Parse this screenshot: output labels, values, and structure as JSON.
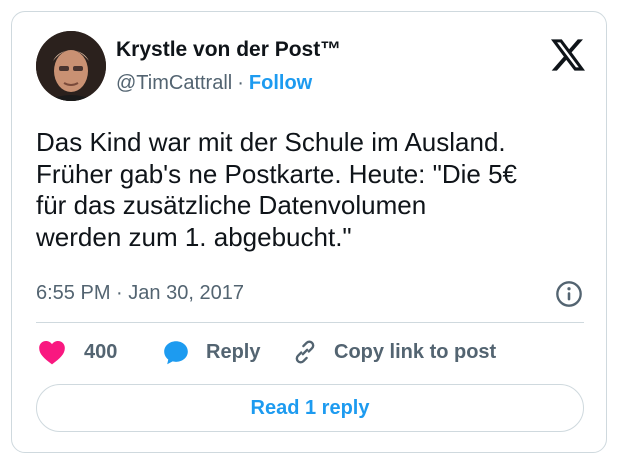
{
  "author": {
    "display_name": "Krystle von der Post™",
    "handle": "@TimCattrall",
    "separator": "·",
    "follow_label": "Follow"
  },
  "tweet": {
    "lines": [
      "Das Kind war mit der Schule im Ausland.",
      "Früher gab's ne Postkarte. Heute: \"Die 5€",
      "für das zusätzliche Datenvolumen",
      "werden zum 1. abgebucht.\""
    ],
    "time": "6:55 PM",
    "date_separator": "·",
    "date": "Jan 30, 2017"
  },
  "actions": {
    "like_count": "400",
    "reply_label": "Reply",
    "copy_link_label": "Copy link to post"
  },
  "read_replies_label": "Read 1 reply",
  "colors": {
    "accent": "#1d9bf0",
    "like": "#f91880",
    "secondary_text": "#536471",
    "border": "#cfd9de"
  },
  "icons": [
    "x-logo-icon",
    "info-icon",
    "heart-icon",
    "reply-bubble-icon",
    "link-icon"
  ]
}
